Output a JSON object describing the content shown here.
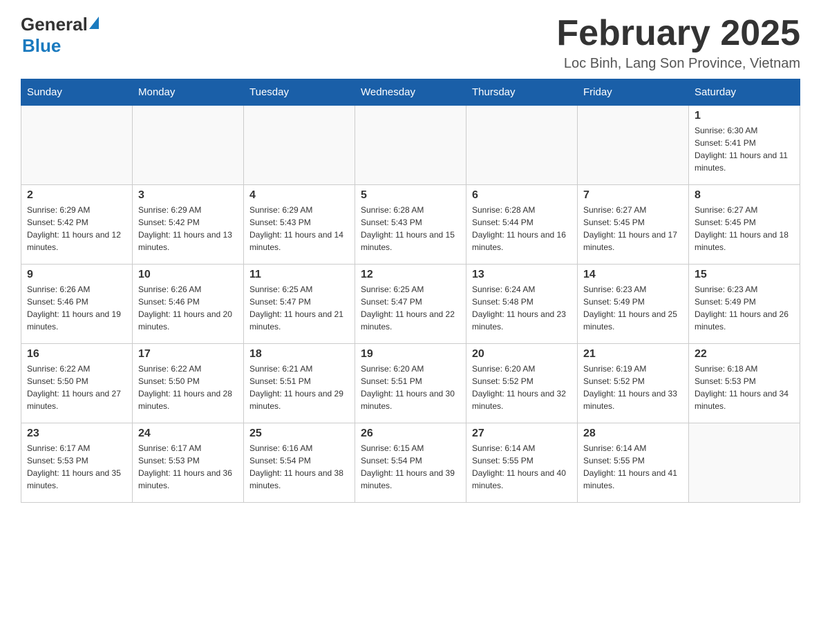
{
  "header": {
    "logo_general": "General",
    "logo_blue": "Blue",
    "main_title": "February 2025",
    "subtitle": "Loc Binh, Lang Son Province, Vietnam"
  },
  "weekdays": [
    "Sunday",
    "Monday",
    "Tuesday",
    "Wednesday",
    "Thursday",
    "Friday",
    "Saturday"
  ],
  "weeks": [
    [
      {
        "day": "",
        "sunrise": "",
        "sunset": "",
        "daylight": ""
      },
      {
        "day": "",
        "sunrise": "",
        "sunset": "",
        "daylight": ""
      },
      {
        "day": "",
        "sunrise": "",
        "sunset": "",
        "daylight": ""
      },
      {
        "day": "",
        "sunrise": "",
        "sunset": "",
        "daylight": ""
      },
      {
        "day": "",
        "sunrise": "",
        "sunset": "",
        "daylight": ""
      },
      {
        "day": "",
        "sunrise": "",
        "sunset": "",
        "daylight": ""
      },
      {
        "day": "1",
        "sunrise": "Sunrise: 6:30 AM",
        "sunset": "Sunset: 5:41 PM",
        "daylight": "Daylight: 11 hours and 11 minutes."
      }
    ],
    [
      {
        "day": "2",
        "sunrise": "Sunrise: 6:29 AM",
        "sunset": "Sunset: 5:42 PM",
        "daylight": "Daylight: 11 hours and 12 minutes."
      },
      {
        "day": "3",
        "sunrise": "Sunrise: 6:29 AM",
        "sunset": "Sunset: 5:42 PM",
        "daylight": "Daylight: 11 hours and 13 minutes."
      },
      {
        "day": "4",
        "sunrise": "Sunrise: 6:29 AM",
        "sunset": "Sunset: 5:43 PM",
        "daylight": "Daylight: 11 hours and 14 minutes."
      },
      {
        "day": "5",
        "sunrise": "Sunrise: 6:28 AM",
        "sunset": "Sunset: 5:43 PM",
        "daylight": "Daylight: 11 hours and 15 minutes."
      },
      {
        "day": "6",
        "sunrise": "Sunrise: 6:28 AM",
        "sunset": "Sunset: 5:44 PM",
        "daylight": "Daylight: 11 hours and 16 minutes."
      },
      {
        "day": "7",
        "sunrise": "Sunrise: 6:27 AM",
        "sunset": "Sunset: 5:45 PM",
        "daylight": "Daylight: 11 hours and 17 minutes."
      },
      {
        "day": "8",
        "sunrise": "Sunrise: 6:27 AM",
        "sunset": "Sunset: 5:45 PM",
        "daylight": "Daylight: 11 hours and 18 minutes."
      }
    ],
    [
      {
        "day": "9",
        "sunrise": "Sunrise: 6:26 AM",
        "sunset": "Sunset: 5:46 PM",
        "daylight": "Daylight: 11 hours and 19 minutes."
      },
      {
        "day": "10",
        "sunrise": "Sunrise: 6:26 AM",
        "sunset": "Sunset: 5:46 PM",
        "daylight": "Daylight: 11 hours and 20 minutes."
      },
      {
        "day": "11",
        "sunrise": "Sunrise: 6:25 AM",
        "sunset": "Sunset: 5:47 PM",
        "daylight": "Daylight: 11 hours and 21 minutes."
      },
      {
        "day": "12",
        "sunrise": "Sunrise: 6:25 AM",
        "sunset": "Sunset: 5:47 PM",
        "daylight": "Daylight: 11 hours and 22 minutes."
      },
      {
        "day": "13",
        "sunrise": "Sunrise: 6:24 AM",
        "sunset": "Sunset: 5:48 PM",
        "daylight": "Daylight: 11 hours and 23 minutes."
      },
      {
        "day": "14",
        "sunrise": "Sunrise: 6:23 AM",
        "sunset": "Sunset: 5:49 PM",
        "daylight": "Daylight: 11 hours and 25 minutes."
      },
      {
        "day": "15",
        "sunrise": "Sunrise: 6:23 AM",
        "sunset": "Sunset: 5:49 PM",
        "daylight": "Daylight: 11 hours and 26 minutes."
      }
    ],
    [
      {
        "day": "16",
        "sunrise": "Sunrise: 6:22 AM",
        "sunset": "Sunset: 5:50 PM",
        "daylight": "Daylight: 11 hours and 27 minutes."
      },
      {
        "day": "17",
        "sunrise": "Sunrise: 6:22 AM",
        "sunset": "Sunset: 5:50 PM",
        "daylight": "Daylight: 11 hours and 28 minutes."
      },
      {
        "day": "18",
        "sunrise": "Sunrise: 6:21 AM",
        "sunset": "Sunset: 5:51 PM",
        "daylight": "Daylight: 11 hours and 29 minutes."
      },
      {
        "day": "19",
        "sunrise": "Sunrise: 6:20 AM",
        "sunset": "Sunset: 5:51 PM",
        "daylight": "Daylight: 11 hours and 30 minutes."
      },
      {
        "day": "20",
        "sunrise": "Sunrise: 6:20 AM",
        "sunset": "Sunset: 5:52 PM",
        "daylight": "Daylight: 11 hours and 32 minutes."
      },
      {
        "day": "21",
        "sunrise": "Sunrise: 6:19 AM",
        "sunset": "Sunset: 5:52 PM",
        "daylight": "Daylight: 11 hours and 33 minutes."
      },
      {
        "day": "22",
        "sunrise": "Sunrise: 6:18 AM",
        "sunset": "Sunset: 5:53 PM",
        "daylight": "Daylight: 11 hours and 34 minutes."
      }
    ],
    [
      {
        "day": "23",
        "sunrise": "Sunrise: 6:17 AM",
        "sunset": "Sunset: 5:53 PM",
        "daylight": "Daylight: 11 hours and 35 minutes."
      },
      {
        "day": "24",
        "sunrise": "Sunrise: 6:17 AM",
        "sunset": "Sunset: 5:53 PM",
        "daylight": "Daylight: 11 hours and 36 minutes."
      },
      {
        "day": "25",
        "sunrise": "Sunrise: 6:16 AM",
        "sunset": "Sunset: 5:54 PM",
        "daylight": "Daylight: 11 hours and 38 minutes."
      },
      {
        "day": "26",
        "sunrise": "Sunrise: 6:15 AM",
        "sunset": "Sunset: 5:54 PM",
        "daylight": "Daylight: 11 hours and 39 minutes."
      },
      {
        "day": "27",
        "sunrise": "Sunrise: 6:14 AM",
        "sunset": "Sunset: 5:55 PM",
        "daylight": "Daylight: 11 hours and 40 minutes."
      },
      {
        "day": "28",
        "sunrise": "Sunrise: 6:14 AM",
        "sunset": "Sunset: 5:55 PM",
        "daylight": "Daylight: 11 hours and 41 minutes."
      },
      {
        "day": "",
        "sunrise": "",
        "sunset": "",
        "daylight": ""
      }
    ]
  ]
}
